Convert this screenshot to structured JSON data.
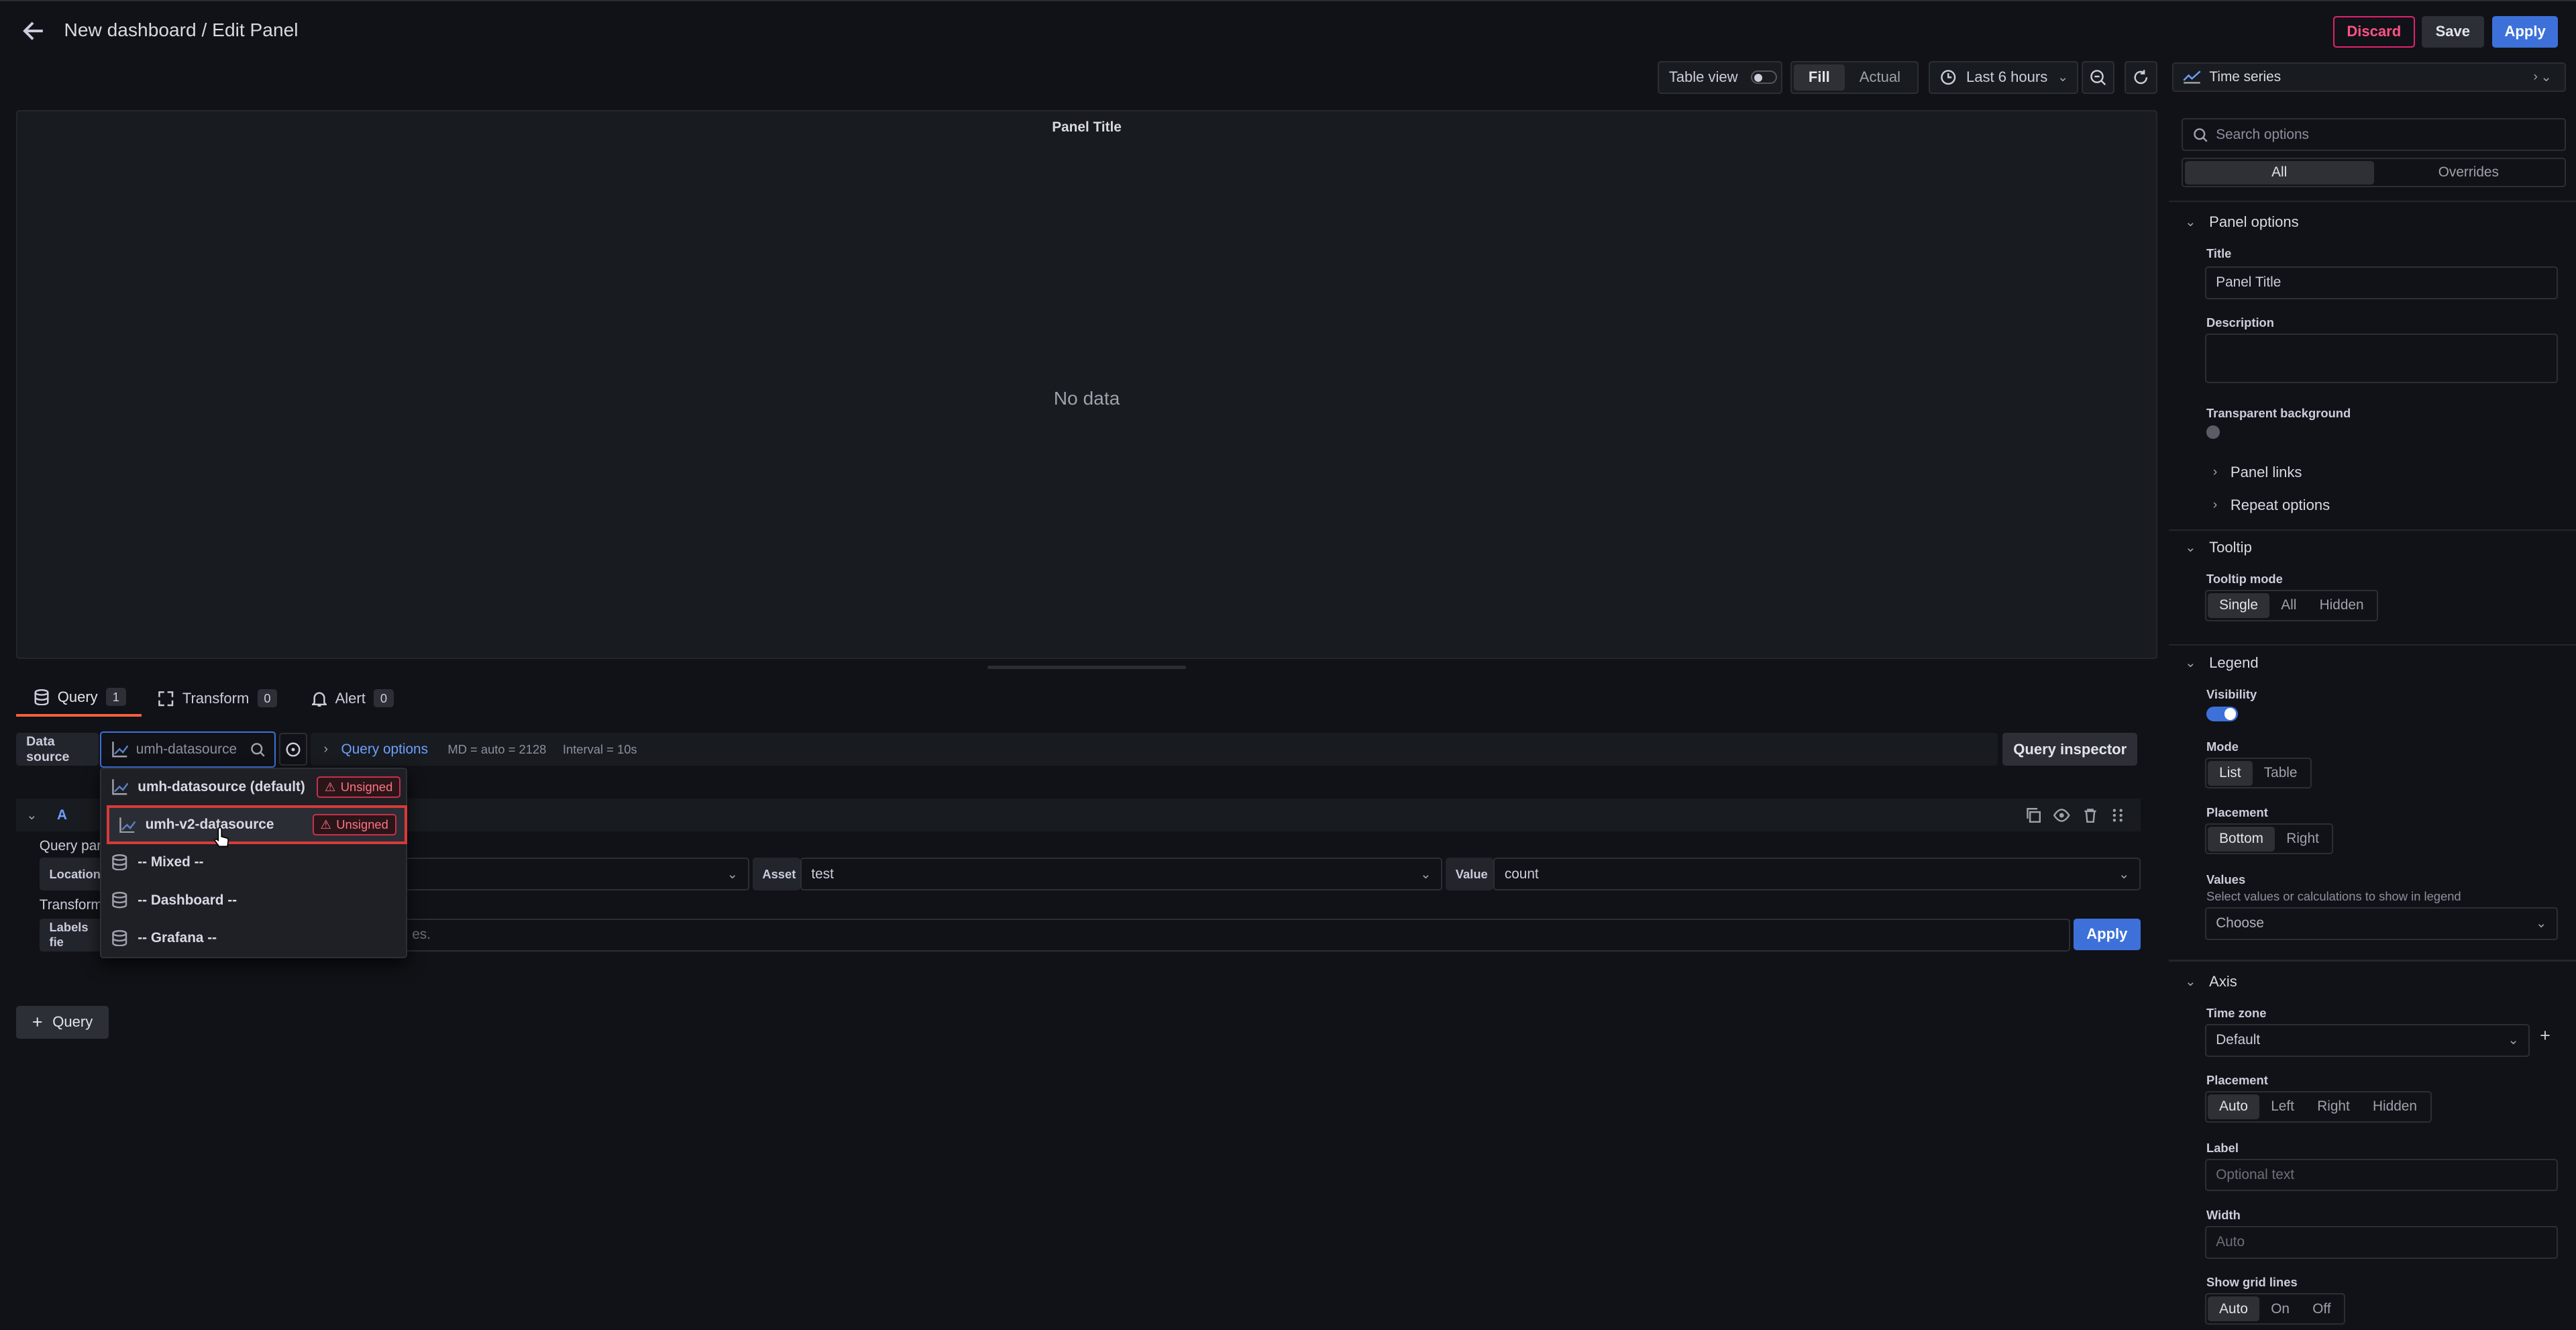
{
  "header": {
    "title": "New dashboard / Edit Panel",
    "discard": "Discard",
    "save": "Save",
    "apply": "Apply"
  },
  "toolbar": {
    "table_view": "Table view",
    "fill": "Fill",
    "actual": "Actual",
    "time_range": "Last 6 hours",
    "visualization": "Time series"
  },
  "panel": {
    "title": "Panel Title",
    "empty": "No data"
  },
  "tabs": [
    {
      "label": "Query",
      "count": "1"
    },
    {
      "label": "Transform",
      "count": "0"
    },
    {
      "label": "Alert",
      "count": "0"
    }
  ],
  "query": {
    "datasource_label": "Data source",
    "datasource_value": "umh-datasource",
    "query_options": "Query options",
    "md": "MD = auto = 2128",
    "interval": "Interval = 10s",
    "inspector": "Query inspector",
    "ref": "A",
    "params_label": "Query par",
    "location_label": "Location",
    "asset_label": "Asset",
    "asset_value": "test",
    "value_label": "Value",
    "value_value": "count",
    "transform_label": "Transform",
    "labels_field": "Labels fie",
    "labels_hint": "es.",
    "apply": "Apply",
    "add_query": "Query"
  },
  "dropdown": {
    "items": [
      {
        "label": "umh-datasource (default)",
        "badge": "Unsigned"
      },
      {
        "label": "umh-v2-datasource",
        "badge": "Unsigned"
      },
      {
        "label": "-- Mixed --"
      },
      {
        "label": "-- Dashboard --"
      },
      {
        "label": "-- Grafana --"
      }
    ]
  },
  "options": {
    "search_placeholder": "Search options",
    "tab_all": "All",
    "tab_overrides": "Overrides",
    "panel_options": "Panel options",
    "title_label": "Title",
    "title_value": "Panel Title",
    "description_label": "Description",
    "transparent_label": "Transparent background",
    "panel_links": "Panel links",
    "repeat_options": "Repeat options",
    "tooltip": "Tooltip",
    "tooltip_mode": "Tooltip mode",
    "tooltip_opts": [
      "Single",
      "All",
      "Hidden"
    ],
    "legend": "Legend",
    "visibility": "Visibility",
    "mode": "Mode",
    "mode_opts": [
      "List",
      "Table"
    ],
    "placement": "Placement",
    "legend_placement_opts": [
      "Bottom",
      "Right"
    ],
    "values": "Values",
    "values_sub": "Select values or calculations to show in legend",
    "values_placeholder": "Choose",
    "axis": "Axis",
    "time_zone": "Time zone",
    "time_zone_value": "Default",
    "axis_placement": "Placement",
    "axis_placement_opts": [
      "Auto",
      "Left",
      "Right",
      "Hidden"
    ],
    "label": "Label",
    "label_placeholder": "Optional text",
    "width": "Width",
    "width_placeholder": "Auto",
    "grid_lines": "Show grid lines",
    "grid_opts": [
      "Auto",
      "On",
      "Off"
    ]
  },
  "colors": {
    "accent": "#3d71d9",
    "discard": "#e0226e",
    "selected_border": "#d63a3a"
  }
}
